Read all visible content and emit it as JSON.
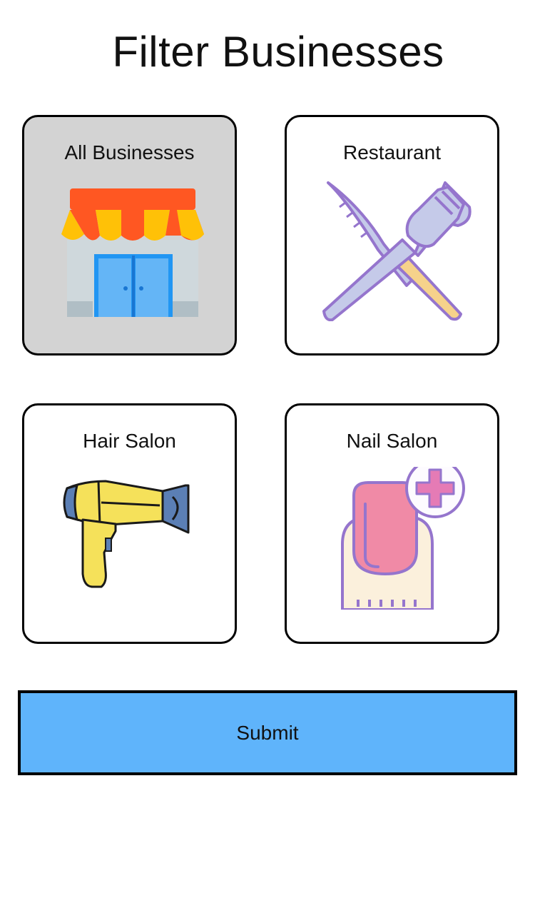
{
  "header": {
    "title": "Filter Businesses"
  },
  "categories": [
    {
      "label": "All Businesses",
      "icon": "storefront-icon",
      "selected": true
    },
    {
      "label": "Restaurant",
      "icon": "knife-fork-icon",
      "selected": false
    },
    {
      "label": "Hair Salon",
      "icon": "hair-dryer-icon",
      "selected": false
    },
    {
      "label": "Nail Salon",
      "icon": "nail-care-icon",
      "selected": false
    }
  ],
  "submit": {
    "label": "Submit"
  },
  "colors": {
    "selected_card_bg": "#d3d3d3",
    "submit_bg": "#5fb4fb",
    "border": "#000000"
  }
}
